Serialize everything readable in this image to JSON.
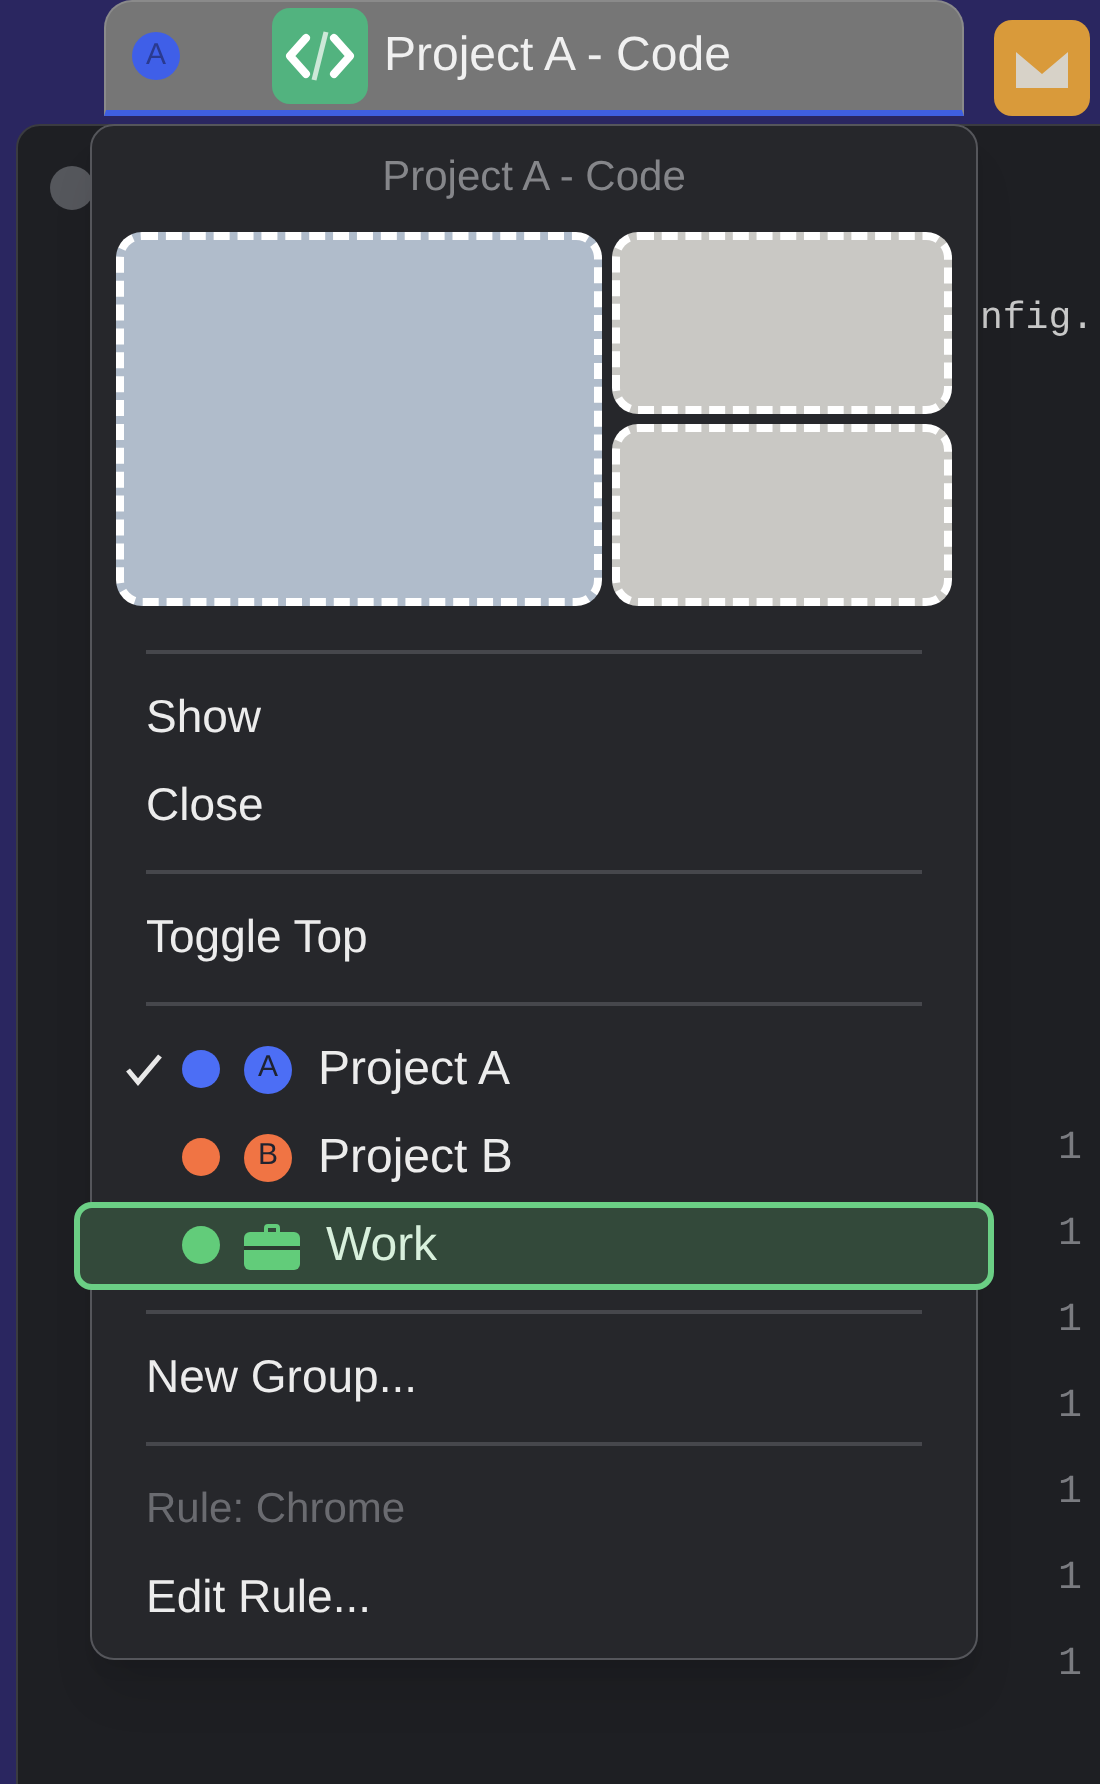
{
  "tab": {
    "badge": "A",
    "title": "Project A - Code"
  },
  "editor": {
    "filename": "nfig.",
    "line_numbers": [
      "1",
      "1",
      "1",
      "1",
      "1",
      "1",
      "1"
    ]
  },
  "menu": {
    "title": "Project A - Code",
    "thumbnails": [
      {
        "color": "#b0bccb"
      },
      {
        "color": "#c9c8c4"
      },
      {
        "color": "#c9c8c4"
      }
    ],
    "items": [
      {
        "kind": "separator"
      },
      {
        "kind": "action",
        "label": "Show",
        "disabled": false
      },
      {
        "kind": "action",
        "label": "Close",
        "disabled": false
      },
      {
        "kind": "separator"
      },
      {
        "kind": "action",
        "label": "Toggle Top",
        "disabled": false
      },
      {
        "kind": "separator"
      },
      {
        "kind": "group",
        "label": "Project A",
        "checked": true,
        "selected": false,
        "color": "#4c6ef5",
        "badge": "A"
      },
      {
        "kind": "group",
        "label": "Project B",
        "checked": false,
        "selected": false,
        "color": "#f07444",
        "badge": "B"
      },
      {
        "kind": "group",
        "label": "Work",
        "checked": false,
        "selected": true,
        "color": "#62cc7a"
      },
      {
        "kind": "separator"
      },
      {
        "kind": "action",
        "label": "New Group...",
        "disabled": false
      },
      {
        "kind": "separator"
      },
      {
        "kind": "action",
        "label": "Rule: Chrome",
        "disabled": true
      },
      {
        "kind": "action",
        "label": "Edit Rule...",
        "disabled": false
      }
    ]
  }
}
